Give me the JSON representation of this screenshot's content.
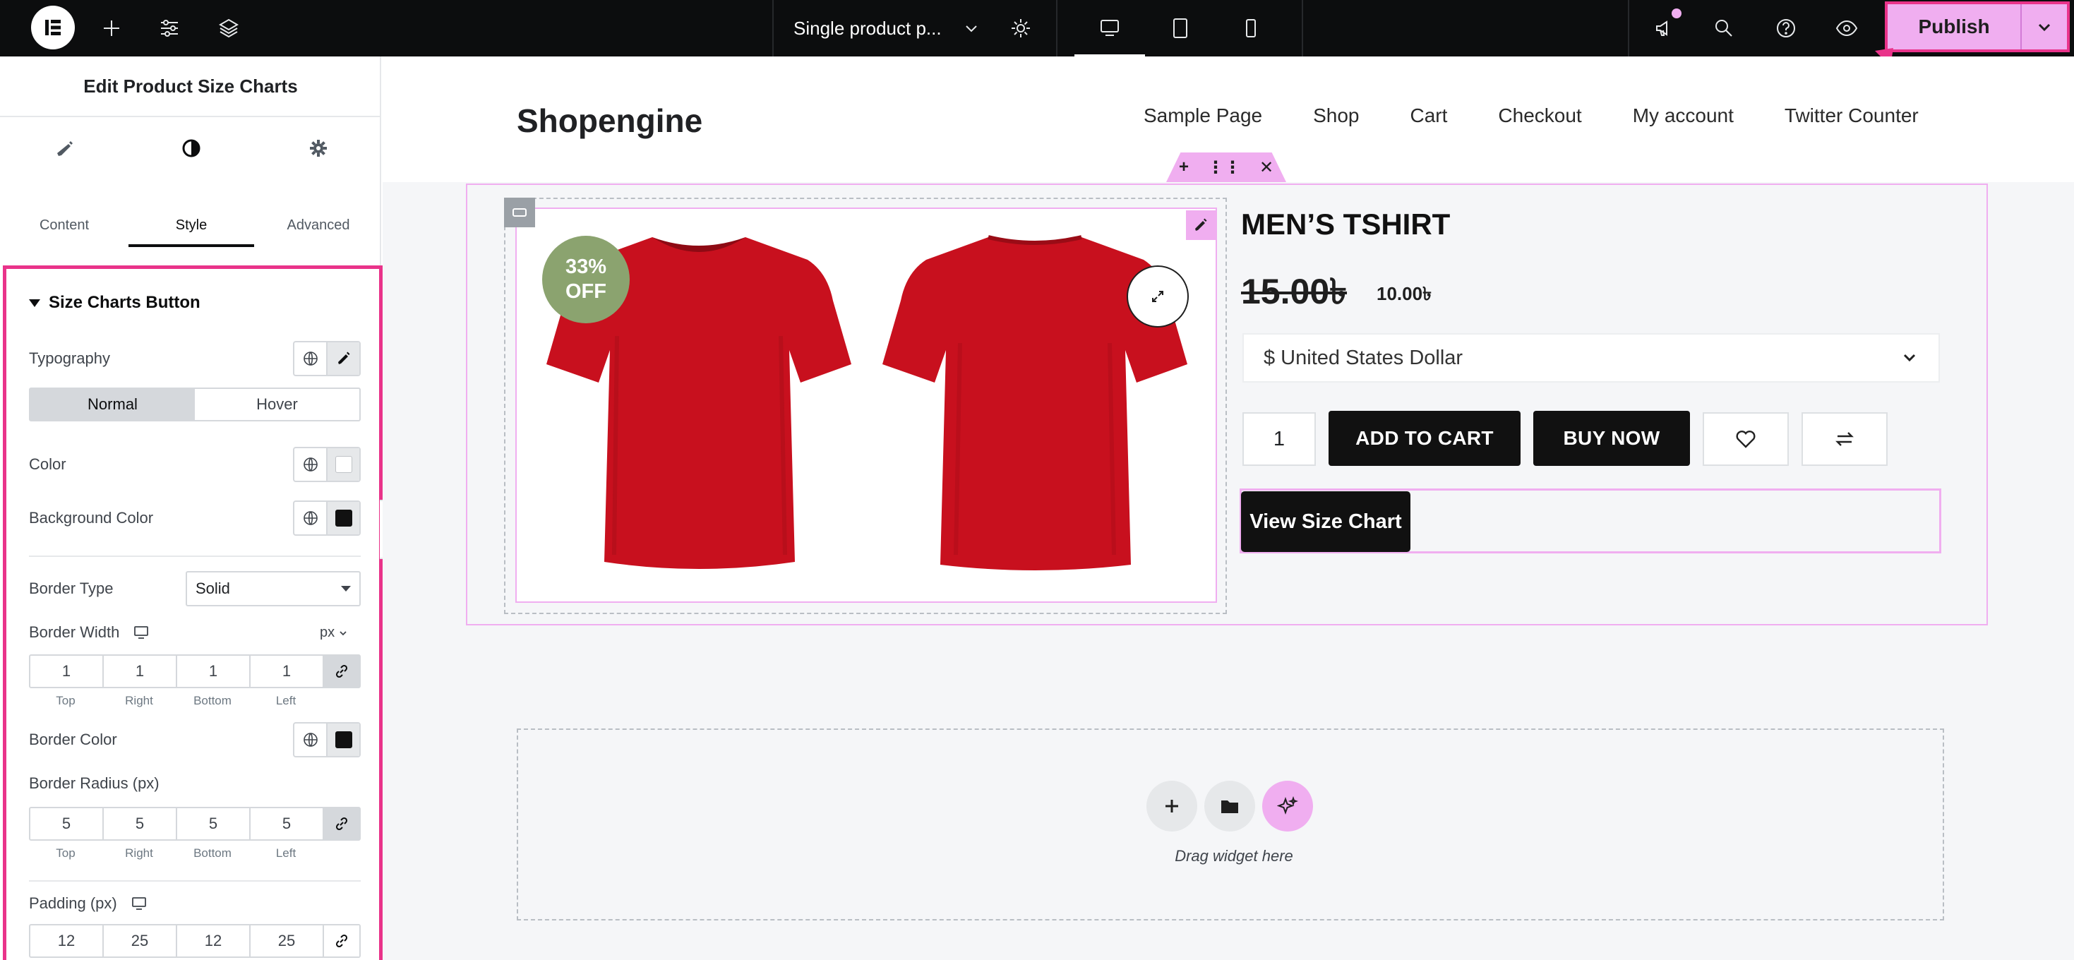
{
  "topbar": {
    "doc_title": "Single product p...",
    "publish_label": "Publish"
  },
  "panel": {
    "title": "Edit Product Size Charts",
    "tabs": [
      {
        "label": "Content",
        "icon": "pencil-icon"
      },
      {
        "label": "Style",
        "icon": "half-circle-icon"
      },
      {
        "label": "Advanced",
        "icon": "gear-icon"
      }
    ],
    "section_title": "Size Charts Button",
    "typography_label": "Typography",
    "state_tabs": [
      "Normal",
      "Hover"
    ],
    "color_label": "Color",
    "bg_color_label": "Background Color",
    "border_type_label": "Border Type",
    "border_type_value": "Solid",
    "border_width_label": "Border Width",
    "border_width_unit": "px",
    "border_width": {
      "top": "1",
      "right": "1",
      "bottom": "1",
      "left": "1"
    },
    "border_color_label": "Border Color",
    "border_radius_label": "Border Radius (px)",
    "border_radius": {
      "top": "5",
      "right": "5",
      "bottom": "5",
      "left": "5"
    },
    "padding_label": "Padding (px)",
    "padding": {
      "top": "12",
      "right": "25",
      "bottom": "12",
      "left": "25"
    },
    "dim_labels": {
      "top": "Top",
      "right": "Right",
      "bottom": "Bottom",
      "left": "Left"
    },
    "colors": {
      "color": "#ffffff",
      "background": "#111111",
      "border": "#111111"
    }
  },
  "site": {
    "brand": "Shopengine",
    "nav": [
      "Sample Page",
      "Shop",
      "Cart",
      "Checkout",
      "My account",
      "Twitter Counter"
    ]
  },
  "product": {
    "badge_line1": "33%",
    "badge_line2": "OFF",
    "title": "MEN’S TSHIRT",
    "price_old": "15.00৳",
    "price_new": "10.00৳",
    "currency": "$ United States Dollar",
    "qty": "1",
    "add_to_cart": "ADD TO CART",
    "buy_now": "BUY NOW",
    "size_chart_button": "View Size Chart"
  },
  "dropzone": {
    "text": "Drag widget here"
  },
  "accent_colors": {
    "highlight": "#e9338a",
    "elementor_pink": "#f0aef0",
    "badge_green": "#8ba36f",
    "shirt_red": "#c8101e"
  }
}
